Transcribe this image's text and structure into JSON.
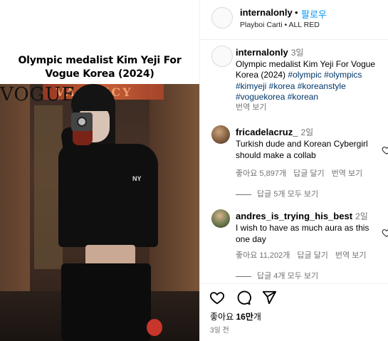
{
  "post": {
    "image_caption_line1": "Olympic medalist Kim Yeji For",
    "image_caption_line2": "Vogue Korea (2024)",
    "magazine_mark": "VOGUE",
    "neon_sign_text": "VACANCY",
    "apparel_logo": "NY",
    "photo_colors": {
      "background": "#3a2c25",
      "outfit": "#0f0f10",
      "accent": "#c8362b"
    }
  },
  "header": {
    "username": "internalonly",
    "separator": "•",
    "follow_label": "팔로우",
    "audio": "Playboi Carti • ALL RED"
  },
  "caption": {
    "username": "internalonly",
    "time": "3일",
    "text": "Olympic medalist Kim Yeji For Vogue Korea (2024)",
    "hashtags": "#olympic #olympics #kimyeji #korea #koreanstyle #voguekorea #korean",
    "translate_label": "번역 보기"
  },
  "comments": [
    {
      "username": "fricadelacruz_",
      "time": "2일",
      "text": "Turkish dude and Korean Cybergirl should make a collab",
      "likes": "좋아요 5,897개",
      "reply_label": "답글 달기",
      "translate_label": "번역 보기",
      "replies_label": "답글 5개 모두 보기"
    },
    {
      "username": "andres_is_trying_his_best",
      "time": "2일",
      "text": "I wish to have as much aura as this one day",
      "likes": "좋아요 11,202개",
      "reply_label": "답글 달기",
      "translate_label": "번역 보기",
      "replies_label": "답글 4개 모두 보기"
    }
  ],
  "footer": {
    "likes_prefix": "좋아요 ",
    "likes_count": "16만",
    "likes_suffix": "개",
    "date": "3일 전"
  },
  "icons": {
    "like": "heart-icon",
    "comment": "comment-icon",
    "share": "share-icon",
    "comment_like": "heart-icon"
  },
  "colors": {
    "follow": "#0095f6",
    "hashtag": "#00376b",
    "muted": "#737373"
  }
}
